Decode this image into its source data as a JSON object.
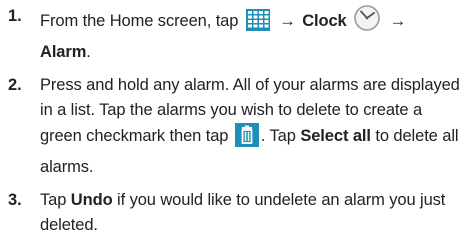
{
  "steps": [
    {
      "number": "1.",
      "part1": "From the Home screen, tap",
      "arrow1": "→",
      "clock_label": "Clock",
      "arrow2": "→",
      "alarm_label": "Alarm",
      "end": "."
    },
    {
      "number": "2.",
      "part1": "Press and hold any alarm. All of your alarms are displayed in a list. Tap the alarms you wish to delete to create a green checkmark then tap",
      "part2": ". Tap",
      "select_all_label": "Select all",
      "part3": "to delete all alarms."
    },
    {
      "number": "3.",
      "part1": "Tap",
      "undo_label": "Undo",
      "part2": "if you would like to undelete an alarm you just deleted."
    }
  ],
  "icons": {
    "apps": "apps-grid-icon",
    "clock": "clock-icon",
    "delete": "trash-icon"
  },
  "colors": {
    "text": "#222222",
    "apps_icon": "#1f8fb5",
    "delete_icon_bg": "#1f8fb5"
  }
}
